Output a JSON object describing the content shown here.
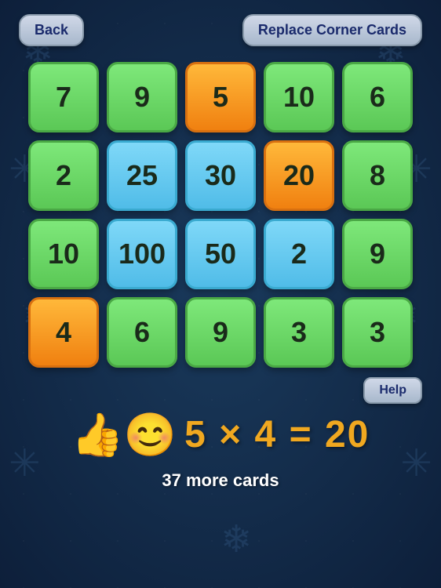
{
  "header": {
    "back_label": "Back",
    "replace_label": "Replace Corner Cards"
  },
  "help": {
    "label": "Help"
  },
  "grid": {
    "cards": [
      {
        "value": "7",
        "color": "green"
      },
      {
        "value": "9",
        "color": "green"
      },
      {
        "value": "5",
        "color": "orange"
      },
      {
        "value": "10",
        "color": "green"
      },
      {
        "value": "6",
        "color": "green"
      },
      {
        "value": "2",
        "color": "green"
      },
      {
        "value": "25",
        "color": "blue"
      },
      {
        "value": "30",
        "color": "blue"
      },
      {
        "value": "20",
        "color": "orange"
      },
      {
        "value": "8",
        "color": "green"
      },
      {
        "value": "10",
        "color": "green"
      },
      {
        "value": "100",
        "color": "blue"
      },
      {
        "value": "50",
        "color": "blue"
      },
      {
        "value": "2",
        "color": "blue"
      },
      {
        "value": "9",
        "color": "green"
      },
      {
        "value": "4",
        "color": "orange"
      },
      {
        "value": "6",
        "color": "green"
      },
      {
        "value": "9",
        "color": "green"
      },
      {
        "value": "3",
        "color": "green"
      },
      {
        "value": "3",
        "color": "green"
      }
    ]
  },
  "equation": {
    "text": "5 × 4 = 20",
    "emoji": "👍😊"
  },
  "footer": {
    "more_cards": "37 more cards"
  }
}
